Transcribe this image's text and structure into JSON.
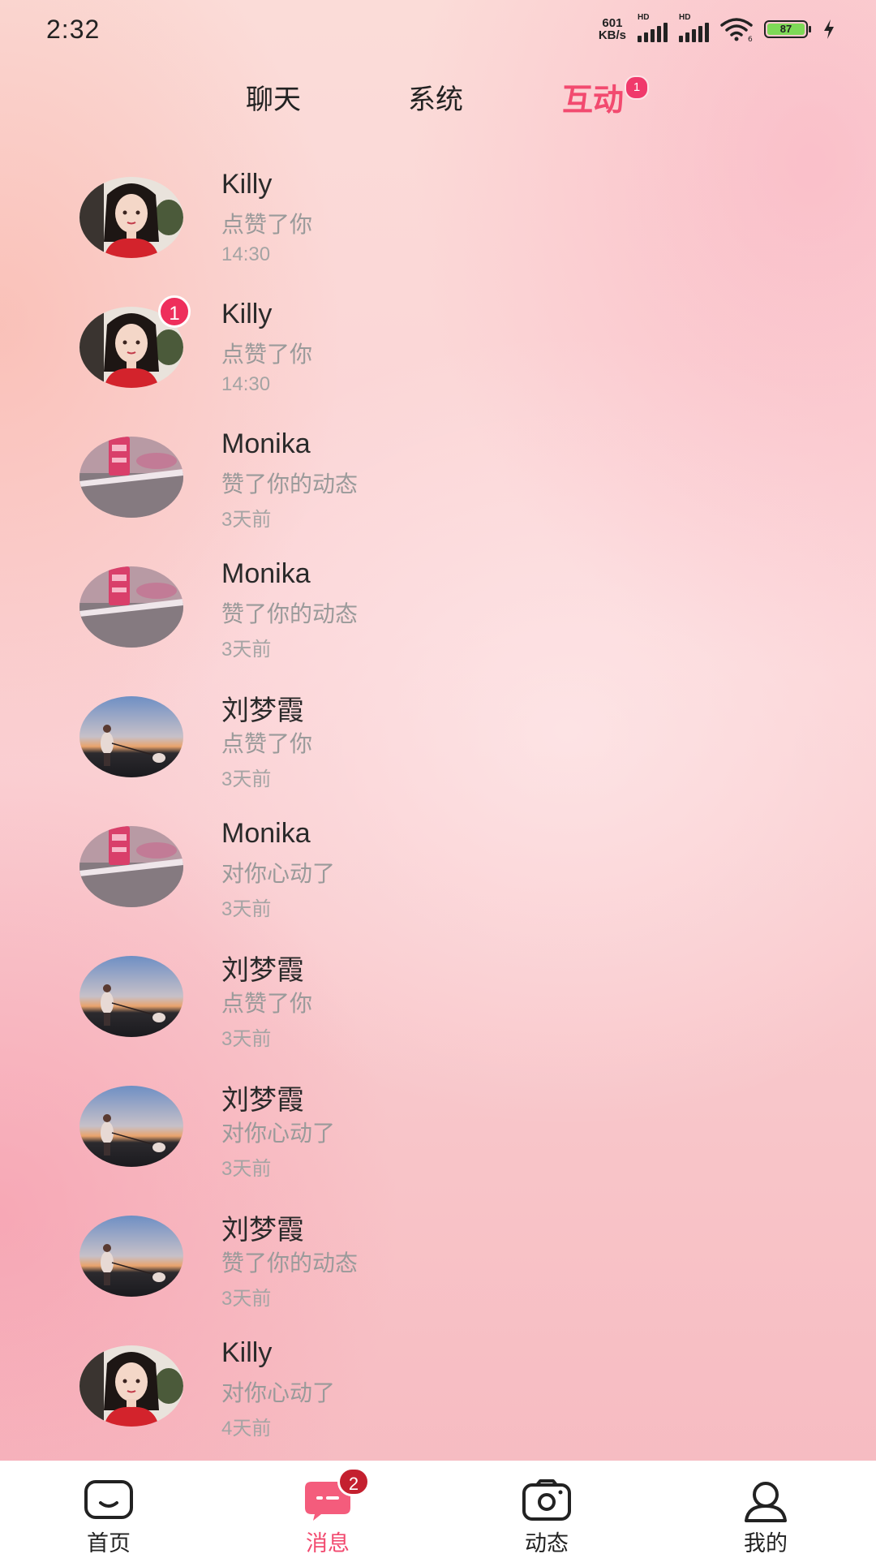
{
  "status_bar": {
    "time": "2:32",
    "net_speed_value": "601",
    "net_speed_unit": "KB/s",
    "hd_label": "HD",
    "battery_level": "87",
    "wifi_label": "6"
  },
  "tabs": [
    {
      "label": "聊天",
      "active": false
    },
    {
      "label": "系统",
      "active": false
    },
    {
      "label": "互动",
      "active": true,
      "badge": "1"
    }
  ],
  "interactions": [
    {
      "name": "Killy",
      "action": "点赞了你",
      "time": "14:30",
      "avatar": "woman-red-dress-avatar"
    },
    {
      "name": "Killy",
      "action": "点赞了你",
      "time": "14:30",
      "avatar": "woman-red-dress-avatar",
      "badge": "1"
    },
    {
      "name": "Monika",
      "action": "赞了你的动态",
      "time": "3天前",
      "avatar": "pink-object-avatar"
    },
    {
      "name": "Monika",
      "action": "赞了你的动态",
      "time": "3天前",
      "avatar": "pink-object-avatar"
    },
    {
      "name": "刘梦霞",
      "action": "点赞了你",
      "time": "3天前",
      "avatar": "sunset-beach-avatar"
    },
    {
      "name": "Monika",
      "action": "对你心动了",
      "time": "3天前",
      "avatar": "pink-object-avatar"
    },
    {
      "name": "刘梦霞",
      "action": "点赞了你",
      "time": "3天前",
      "avatar": "sunset-beach-avatar"
    },
    {
      "name": "刘梦霞",
      "action": "对你心动了",
      "time": "3天前",
      "avatar": "sunset-beach-avatar"
    },
    {
      "name": "刘梦霞",
      "action": "赞了你的动态",
      "time": "3天前",
      "avatar": "sunset-beach-avatar"
    },
    {
      "name": "Killy",
      "action": "对你心动了",
      "time": "4天前",
      "avatar": "woman-red-dress-avatar"
    }
  ],
  "bottom_nav": [
    {
      "label": "首页",
      "icon": "home-icon",
      "active": false
    },
    {
      "label": "消息",
      "icon": "message-icon",
      "active": true,
      "badge": "2"
    },
    {
      "label": "动态",
      "icon": "camera-icon",
      "active": false
    },
    {
      "label": "我的",
      "icon": "profile-icon",
      "active": false
    }
  ],
  "colors": {
    "accent": "#f24a6f",
    "badge": "#ee2f5c",
    "nav_badge": "#c4202f"
  }
}
